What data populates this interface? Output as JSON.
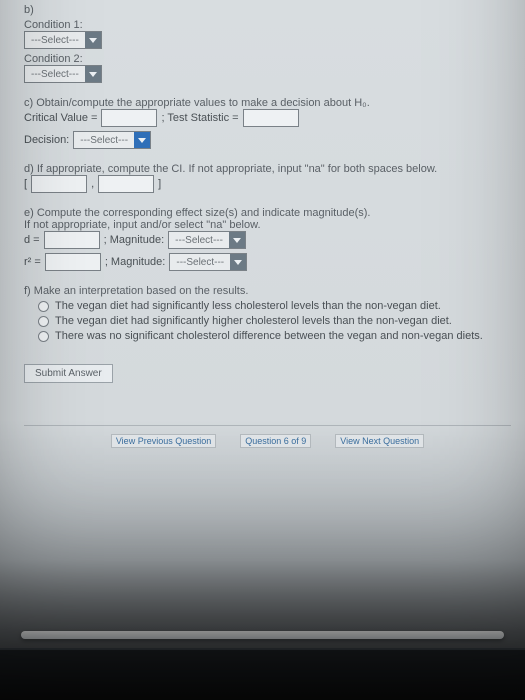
{
  "b": {
    "label": "b)",
    "cond1_label": "Condition 1:",
    "cond2_label": "Condition 2:",
    "select_placeholder": "---Select---"
  },
  "c": {
    "prompt": "c) Obtain/compute the appropriate values to make a decision about H₀.",
    "crit_label": "Critical Value =",
    "test_label": "; Test Statistic =",
    "decision_label": "Decision:",
    "select_placeholder": "---Select---"
  },
  "d": {
    "prompt": "d) If appropriate, compute the CI. If not appropriate, input \"na\" for both spaces below.",
    "open": "[",
    "comma": ",",
    "close": "]"
  },
  "e": {
    "prompt": "e) Compute the corresponding effect size(s) and indicate magnitude(s).",
    "sub": "If not appropriate, input and/or select \"na\" below.",
    "d_label": "d =",
    "r2_label": "r² =",
    "mag_label": "; Magnitude:",
    "select_placeholder": "---Select---"
  },
  "f": {
    "prompt": "f) Make an interpretation based on the results.",
    "opt1": "The vegan diet had significantly less cholesterol levels than the non-vegan diet.",
    "opt2": "The vegan diet had significantly higher cholesterol levels than the non-vegan diet.",
    "opt3": "There was no significant cholesterol difference between the vegan and non-vegan diets."
  },
  "submit": "Submit Answer",
  "nav": {
    "prev": "View Previous Question",
    "pos": "Question 6 of 9",
    "next": "View Next Question"
  }
}
